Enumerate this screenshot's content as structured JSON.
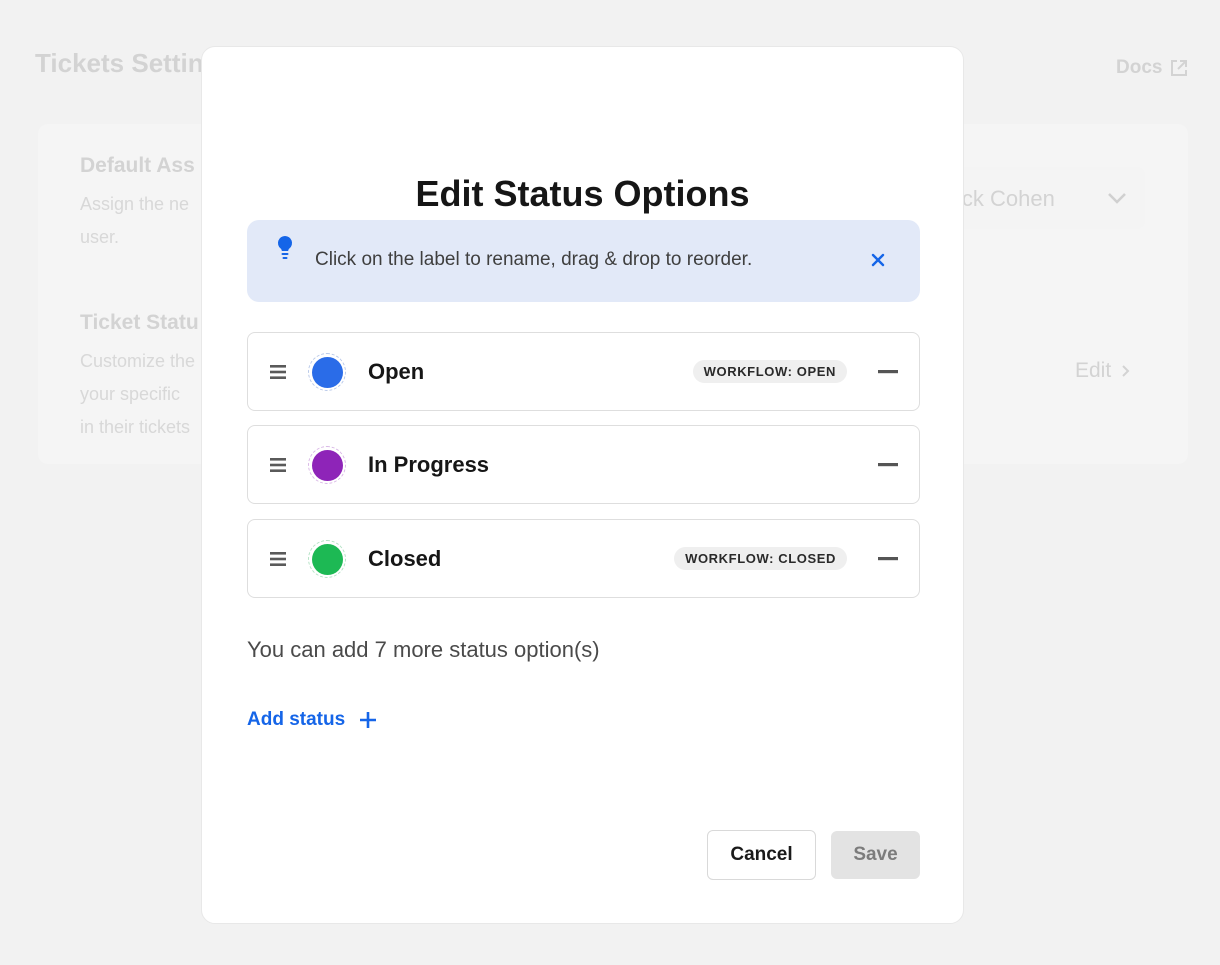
{
  "background": {
    "page_title": "Tickets Settin",
    "docs_label": "Docs",
    "default_assignee": {
      "title": "Default Ass",
      "description": "Assign the ne\nuser.",
      "selected_value": "ick Cohen"
    },
    "ticket_status": {
      "title": "Ticket Statu",
      "description": "Customize the\nyour specific\nin their tickets",
      "edit_label": "Edit"
    }
  },
  "modal": {
    "title": "Edit Status Options",
    "tip": {
      "text": "Click on the label to rename, drag & drop to reorder."
    },
    "statuses": [
      {
        "label": "Open",
        "color": "#2a6ce8",
        "ring_color": "#b9c9e9",
        "workflow": "WORKFLOW: OPEN"
      },
      {
        "label": "In Progress",
        "color": "#8e24b8",
        "ring_color": "#d9b7e6",
        "workflow": ""
      },
      {
        "label": "Closed",
        "color": "#1db954",
        "ring_color": "#b3e2c4",
        "workflow": "WORKFLOW: CLOSED"
      }
    ],
    "remaining_text": "You can add 7 more status option(s)",
    "add_status_label": "Add status",
    "cancel_label": "Cancel",
    "save_label": "Save"
  },
  "colors": {
    "accent": "#1565e8",
    "tip_background": "#e2e9f8"
  },
  "icons": {
    "tip": "lightbulb-icon",
    "close": "close-icon",
    "drag": "drag-handle-icon",
    "remove": "minus-icon",
    "add": "plus-icon",
    "docs": "external-link-icon"
  }
}
